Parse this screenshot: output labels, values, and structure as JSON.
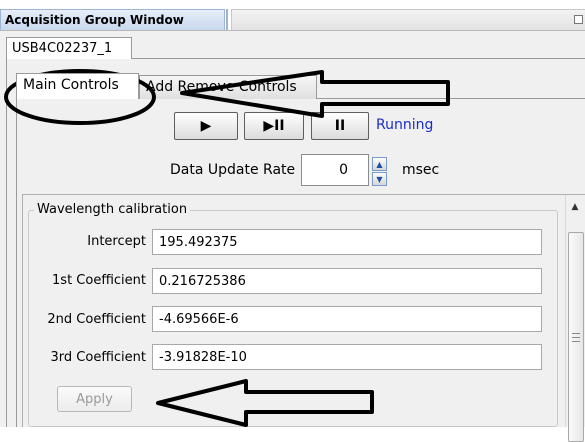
{
  "window": {
    "title": "Acquisition Group Window",
    "device_tab": "USB4C02237_1"
  },
  "tabs": [
    {
      "label": "Main Controls",
      "active": true
    },
    {
      "label": "Add Remove Controls",
      "active": false
    }
  ],
  "controls": {
    "start_glyph": "▶",
    "step_glyph": "▶II",
    "pause_glyph": "II",
    "status": "Running",
    "rate_label": "Data Update Rate",
    "rate_value": "0",
    "rate_unit": "msec"
  },
  "calibration": {
    "legend": "Wavelength calibration",
    "rows": [
      {
        "label": "Intercept",
        "value": "195.492375"
      },
      {
        "label": "1st Coefficient",
        "value": "0.216725386"
      },
      {
        "label": "2nd Coefficient",
        "value": "-4.69566E-6"
      },
      {
        "label": "3rd Coefficient",
        "value": "-3.91828E-10"
      }
    ],
    "apply_label": "Apply"
  },
  "colors": {
    "status": "#1a2ccc",
    "annotation": "#000000"
  }
}
